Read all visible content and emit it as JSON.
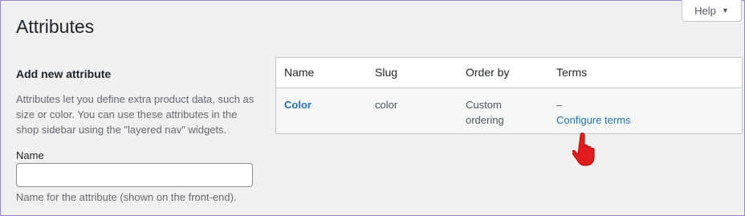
{
  "header": {
    "help_label": "Help",
    "page_title": "Attributes"
  },
  "form": {
    "section_title": "Add new attribute",
    "description": "Attributes let you define extra product data, such as size or color. You can use these attributes in the shop sidebar using the \"layered nav\" widgets.",
    "name_label": "Name",
    "name_value": "",
    "name_hint": "Name for the attribute (shown on the front-end)."
  },
  "table": {
    "columns": [
      "Name",
      "Slug",
      "Order by",
      "Terms"
    ],
    "rows": [
      {
        "name": "Color",
        "slug": "color",
        "order_by": "Custom ordering",
        "terms_dash": "–",
        "configure_link": "Configure terms"
      }
    ]
  },
  "cursor": {
    "icon": "hand-pointer-icon",
    "color": "#e01e1e"
  }
}
